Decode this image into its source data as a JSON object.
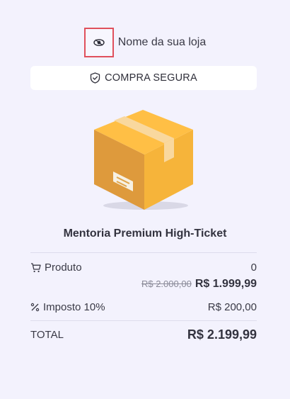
{
  "store": {
    "name": "Nome da sua loja",
    "logo_icon": "eye-logo-icon"
  },
  "banner": {
    "label": "COMPRA SEGURA",
    "icon": "shield-check-icon"
  },
  "product": {
    "title": "Mentoria Premium High-Ticket",
    "image_icon": "box-icon"
  },
  "summary": {
    "product_label": "Produto",
    "product_icon": "cart-icon",
    "product_quantity": "0",
    "old_price": "R$ 2.000,00",
    "new_price": "R$ 1.999,99",
    "tax_label": "Imposto 10%",
    "tax_icon": "percent-icon",
    "tax_value": "R$ 200,00",
    "total_label": "TOTAL",
    "total_value": "R$ 2.199,99"
  },
  "colors": {
    "background": "#f3f2fd",
    "logo_border": "#e0505c",
    "box_main": "#f6b43a",
    "box_side": "#de9a3c"
  }
}
